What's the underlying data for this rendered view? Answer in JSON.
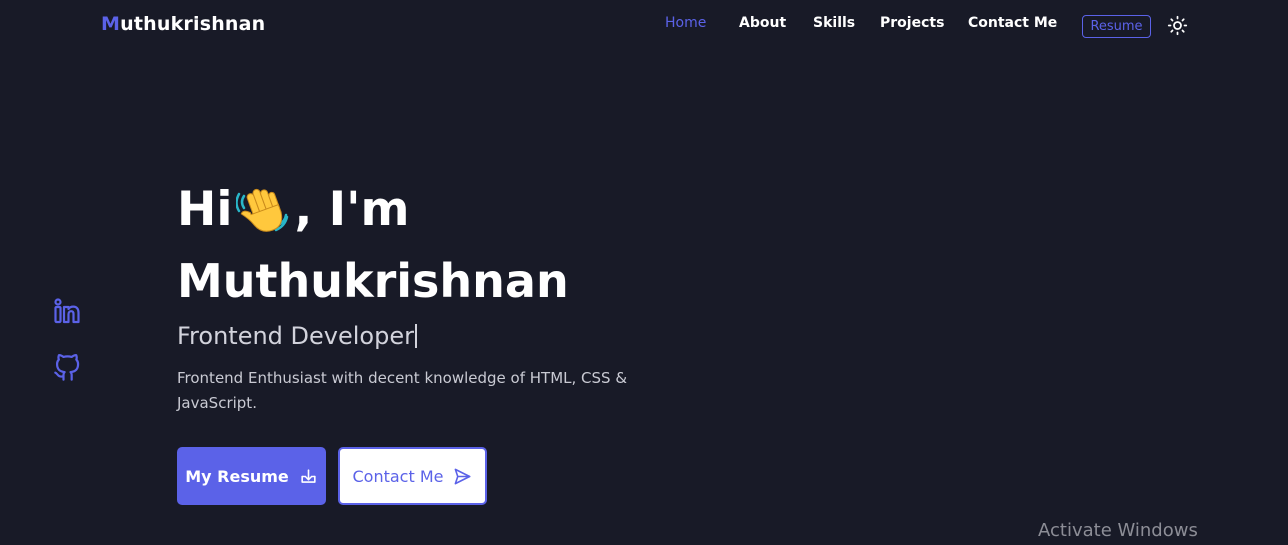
{
  "header": {
    "logo_first_letter": "M",
    "logo_rest": "uthukrishnan",
    "nav": [
      {
        "label": "Home",
        "active": true
      },
      {
        "label": "About",
        "active": false
      },
      {
        "label": "Skills",
        "active": false
      },
      {
        "label": "Projects",
        "active": false
      },
      {
        "label": "Contact Me",
        "active": false
      }
    ],
    "resume_label": "Resume",
    "theme_icon": "sun-icon"
  },
  "social": [
    {
      "icon": "linkedin-icon"
    },
    {
      "icon": "github-icon"
    }
  ],
  "hero": {
    "greeting_pre": "Hi",
    "greeting_emoji": "waving-hand-icon",
    "greeting_post": ", I'm",
    "name": "Muthukrishnan",
    "role": "Frontend Developer",
    "description": "Frontend Enthusiast with decent knowledge of HTML, CSS & JavaScript."
  },
  "actions": {
    "primary_label": "My Resume",
    "primary_icon": "download-icon",
    "secondary_label": "Contact Me",
    "secondary_icon": "send-icon"
  },
  "watermark": "Activate Windows",
  "colors": {
    "background": "#181a27",
    "accent": "#5b62e8",
    "text": "#ffffff"
  }
}
